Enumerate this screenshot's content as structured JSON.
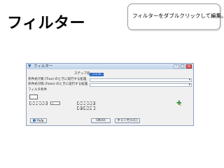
{
  "slide": {
    "title": "フィルター",
    "callout": "フィルターをダブルクリックして編集。"
  },
  "dialog": {
    "title": "フィルター",
    "icon": "filter-icon",
    "fields": {
      "step_name_label": "ステップ名",
      "step_name_value": "フィルター",
      "true_condition_label": "条件式が真 (True) のときに実行する処理",
      "false_condition_label": "条件式が偽 (False) のときに実行する処理",
      "filter_condition_label": "フィルタ条件"
    },
    "condition_tags": {
      "left_value": "<フィールド>",
      "operator": "=",
      "right_value": "<フィールド>",
      "right_constant": "<値を入力>"
    },
    "buttons": {
      "help": "Help",
      "ok": "OK(O)",
      "cancel": "キャンセル(C)"
    },
    "colors": {
      "selection": "#3875d7",
      "titlebar": "#c9daf0",
      "add_condition_icon": "#2e8b3e"
    }
  }
}
